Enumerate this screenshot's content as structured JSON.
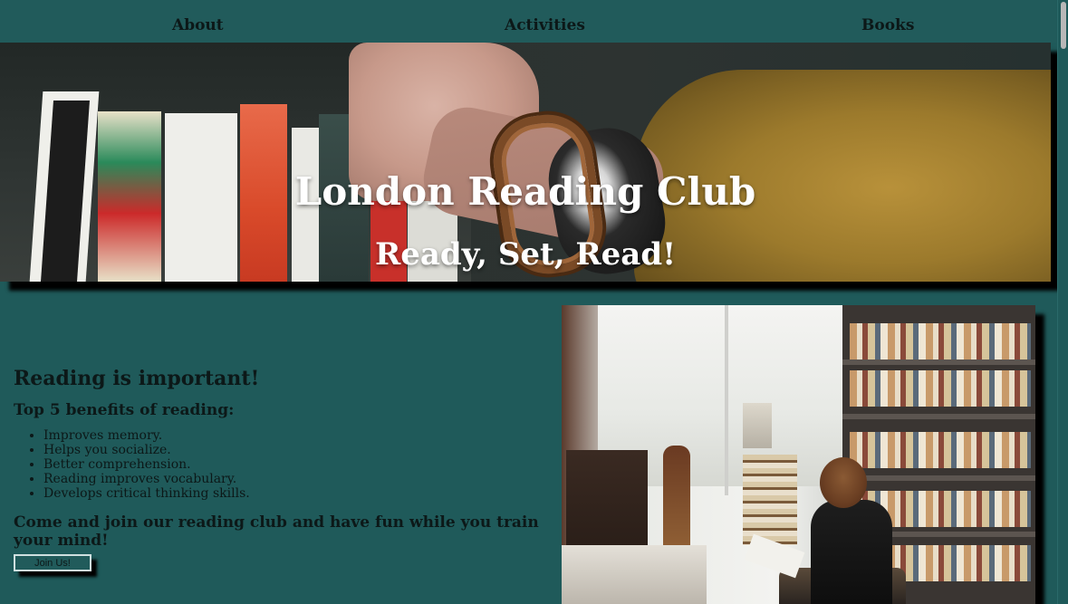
{
  "nav": {
    "items": [
      {
        "label": "About"
      },
      {
        "label": "Activities"
      },
      {
        "label": "Books"
      }
    ]
  },
  "hero": {
    "title": "London Reading Club",
    "subtitle": "Ready, Set, Read!"
  },
  "content": {
    "heading": "Reading is important!",
    "subheading": "Top 5 benefits of reading:",
    "benefits": [
      "Improves memory.",
      "Helps you socialize.",
      "Better comprehension.",
      "Reading improves vocabulary.",
      "Develops critical thinking skills."
    ],
    "cta_text": "Come and join our reading club and have fun while you train your mind!",
    "join_button_label": "Join Us!"
  },
  "colors": {
    "page_background": "#1f5a5a",
    "nav_background": "#215b5b",
    "text": "#0c1818",
    "hero_text": "#ffffff"
  }
}
